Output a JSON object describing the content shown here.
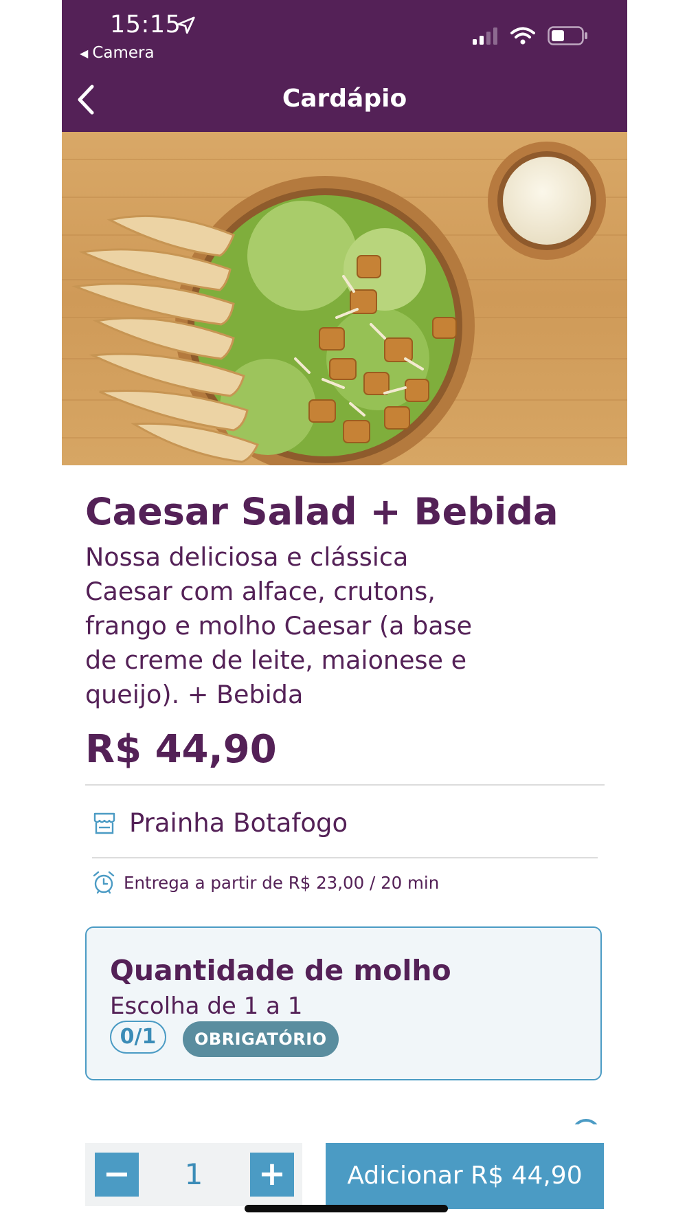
{
  "status_bar": {
    "time": "15:15",
    "back_app": "Camera"
  },
  "nav": {
    "title": "Cardápio"
  },
  "product": {
    "title": "Caesar Salad + Bebida",
    "description": "Nossa deliciosa e clássica Caesar com alface, crutons, frango e molho Caesar (a base de creme de leite, maionese e queijo). + Bebida",
    "price": "R$ 44,90"
  },
  "store": {
    "name": "Prainha Botafogo",
    "icon": "storefront-icon"
  },
  "delivery": {
    "text": "Entrega a partir de R$ 23,00 / 20 min",
    "icon": "alarm-clock-icon"
  },
  "option_group": {
    "title": "Quantidade de molho",
    "subtitle": "Escolha de 1 a 1",
    "count": "0/1",
    "required_label": "OBRIGATÓRIO"
  },
  "cart": {
    "quantity": "1",
    "minus_label": "−",
    "plus_label": "+",
    "add_button_label": "Adicionar R$ 44,90"
  },
  "colors": {
    "brand_purple": "#542157",
    "accent_blue": "#4b9bc4",
    "required_badge": "#5a8d9f"
  }
}
